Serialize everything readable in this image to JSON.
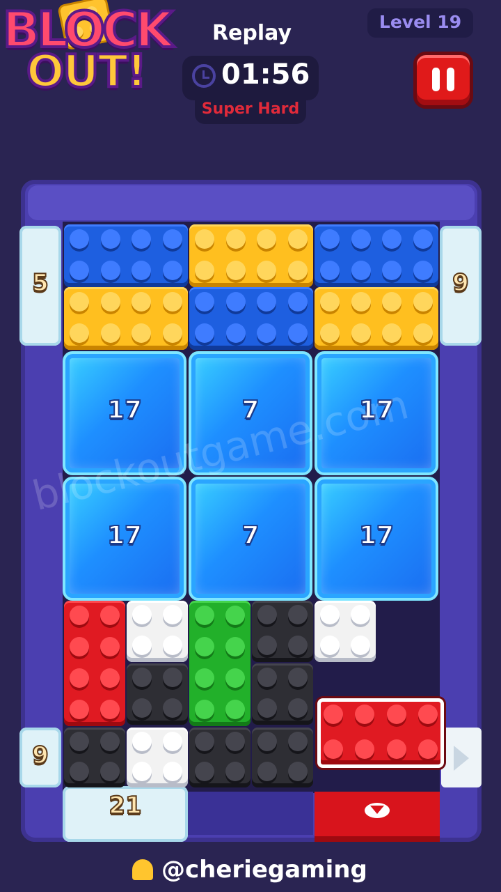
{
  "logo": {
    "line1": "BLOCK",
    "line2": "OUT!"
  },
  "header": {
    "mode": "Replay",
    "timer": "01:56",
    "difficulty": "Super Hard",
    "level": "Level 19"
  },
  "colors": {
    "red": "#e01a22",
    "yellow": "#ffbf1f",
    "blue": "#1e5fe0",
    "white": "#f2f2f2",
    "black": "#2e2e34",
    "green": "#22b02a"
  },
  "gates": {
    "left_top": "5",
    "right_top": "9",
    "left_bottom": "9",
    "bottom_left": "21"
  },
  "ice_blocks": [
    "17",
    "7",
    "17",
    "17",
    "7",
    "17"
  ],
  "watermark": "blockoutgame.com",
  "footer": {
    "handle": "@cheriegaming"
  }
}
